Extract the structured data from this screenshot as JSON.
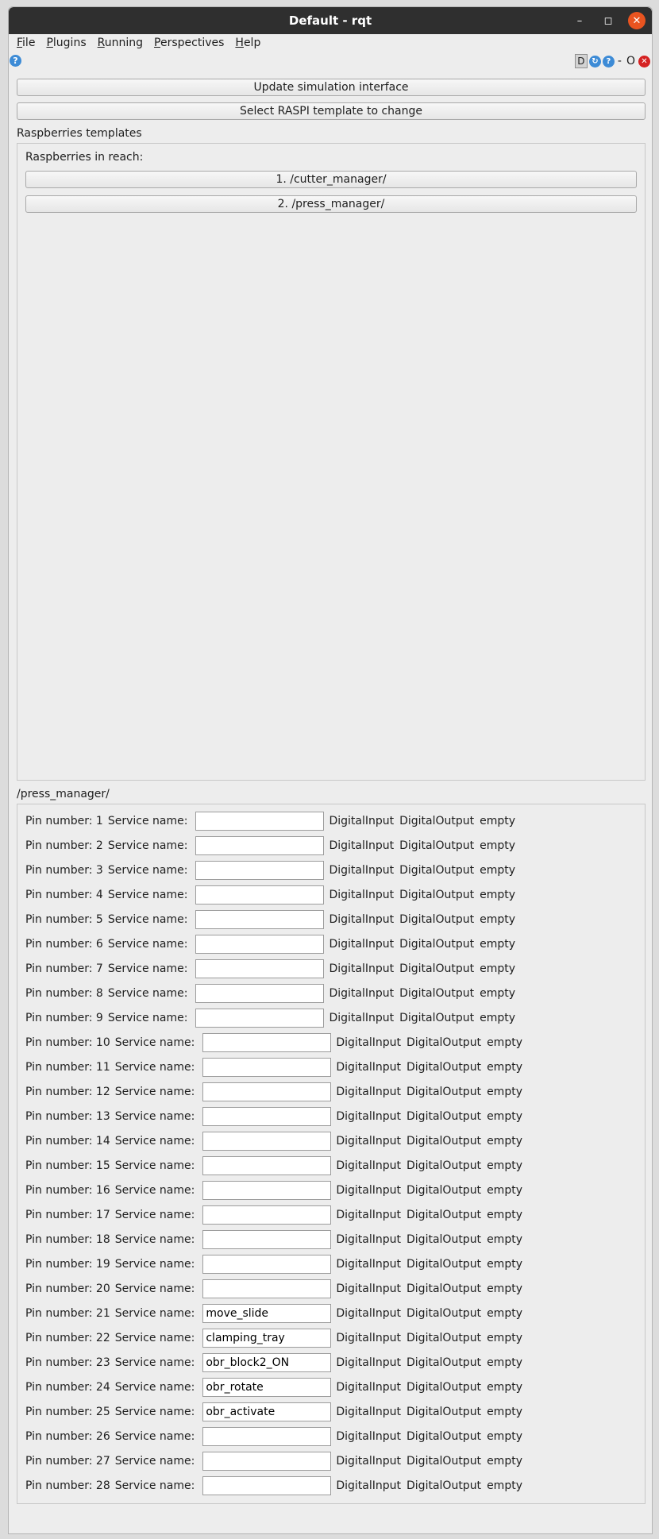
{
  "window": {
    "title": "Default - rqt"
  },
  "menu": [
    {
      "u": "F",
      "rest": "ile"
    },
    {
      "u": "P",
      "rest": "lugins"
    },
    {
      "u": "R",
      "rest": "unning"
    },
    {
      "u": "P",
      "rest": "erspectives"
    },
    {
      "u": "H",
      "rest": "elp"
    }
  ],
  "dock": {
    "d_label": "D",
    "minus": "-",
    "o_label": "O"
  },
  "buttons": {
    "update": "Update simulation interface",
    "select": "Select RASPI template to change"
  },
  "templates": {
    "group_title": "Raspberries templates",
    "inner_title": "Raspberries in reach:",
    "items": [
      "1.  /cutter_manager/",
      "2.  /press_manager/"
    ]
  },
  "pins": {
    "group_title": "/press_manager/",
    "service_label": "Service name:",
    "labels": {
      "digital_input": "DigitalInput",
      "digital_output": "DigitalOutput",
      "empty": "empty"
    },
    "rows": [
      {
        "pin": "Pin number: 1",
        "value": ""
      },
      {
        "pin": "Pin number: 2",
        "value": ""
      },
      {
        "pin": "Pin number: 3",
        "value": ""
      },
      {
        "pin": "Pin number: 4",
        "value": ""
      },
      {
        "pin": "Pin number: 5",
        "value": ""
      },
      {
        "pin": "Pin number: 6",
        "value": ""
      },
      {
        "pin": "Pin number: 7",
        "value": ""
      },
      {
        "pin": "Pin number: 8",
        "value": ""
      },
      {
        "pin": "Pin number: 9",
        "value": ""
      },
      {
        "pin": "Pin number: 10",
        "value": ""
      },
      {
        "pin": "Pin number: 11",
        "value": ""
      },
      {
        "pin": "Pin number: 12",
        "value": ""
      },
      {
        "pin": "Pin number: 13",
        "value": ""
      },
      {
        "pin": "Pin number: 14",
        "value": ""
      },
      {
        "pin": "Pin number: 15",
        "value": ""
      },
      {
        "pin": "Pin number: 16",
        "value": ""
      },
      {
        "pin": "Pin number: 17",
        "value": ""
      },
      {
        "pin": "Pin number: 18",
        "value": ""
      },
      {
        "pin": "Pin number: 19",
        "value": ""
      },
      {
        "pin": "Pin number: 20",
        "value": ""
      },
      {
        "pin": "Pin number: 21",
        "value": "move_slide"
      },
      {
        "pin": "Pin number: 22",
        "value": "clamping_tray"
      },
      {
        "pin": "Pin number: 23",
        "value": "obr_block2_ON"
      },
      {
        "pin": "Pin number: 24",
        "value": "obr_rotate"
      },
      {
        "pin": "Pin number: 25",
        "value": "obr_activate"
      },
      {
        "pin": "Pin number: 26",
        "value": ""
      },
      {
        "pin": "Pin number: 27",
        "value": ""
      },
      {
        "pin": "Pin number: 28",
        "value": ""
      }
    ]
  }
}
